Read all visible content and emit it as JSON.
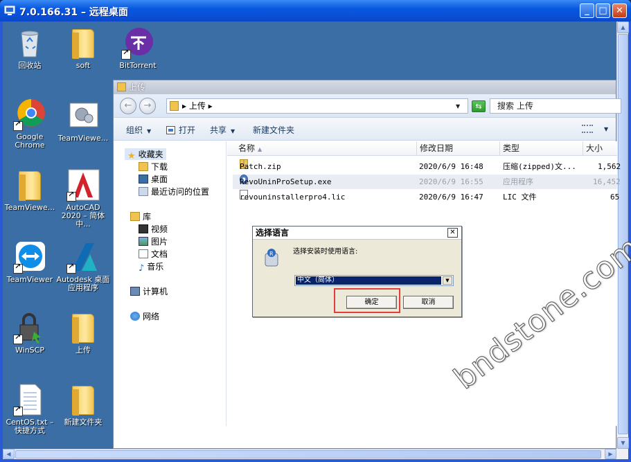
{
  "window": {
    "title": "7.0.166.31 – 远程桌面",
    "min_label": "_",
    "max_label": "□",
    "close_label": "✕"
  },
  "desktop": {
    "icons": [
      {
        "label": "回收站",
        "icon": "recycle-bin-icon"
      },
      {
        "label": "soft",
        "icon": "folder-icon"
      },
      {
        "label": "BitTorrent",
        "icon": "bittorrent-icon"
      },
      {
        "label": "Google Chrome",
        "icon": "chrome-icon"
      },
      {
        "label": "TeamViewe...",
        "icon": "teamviewer-config-icon"
      },
      {
        "label": "TeamViewe...",
        "icon": "folder-icon"
      },
      {
        "label": "AutoCAD 2020 – 简体中...",
        "icon": "autocad-icon"
      },
      {
        "label": "TeamViewer",
        "icon": "teamviewer-icon"
      },
      {
        "label": "Autodesk 桌面应用程序",
        "icon": "autodesk-app-icon"
      },
      {
        "label": "WinSCP",
        "icon": "winscp-icon"
      },
      {
        "label": "上传",
        "icon": "folder-icon"
      },
      {
        "label": "CentOS.txt – 快捷方式",
        "icon": "text-file-icon"
      },
      {
        "label": "新建文件夹",
        "icon": "folder-icon"
      }
    ]
  },
  "explorer": {
    "title": "上传",
    "address": "▸ 上传 ▸",
    "search_placeholder": "搜索 上传",
    "toolbar": {
      "organize": "组织",
      "open": "打开",
      "share": "共享",
      "new_folder": "新建文件夹"
    },
    "nav": {
      "favorites": "收藏夹",
      "downloads": "下载",
      "desktop": "桌面",
      "recent": "最近访问的位置",
      "libraries": "库",
      "videos": "视频",
      "pictures": "图片",
      "documents": "文档",
      "music": "音乐",
      "computer": "计算机",
      "network": "网络"
    },
    "columns": {
      "name": "名称",
      "modified": "修改日期",
      "type": "类型",
      "size": "大小"
    },
    "files": [
      {
        "name": "Patch.zip",
        "modified": "2020/6/9 16:48",
        "type": "压缩(zipped)文...",
        "size": "1,562"
      },
      {
        "name": "RevoUninProSetup.exe",
        "modified": "2020/6/9 16:55",
        "type": "应用程序",
        "size": "16,452"
      },
      {
        "name": "revouninstallerpro4.lic",
        "modified": "2020/6/9 16:47",
        "type": "LIC 文件",
        "size": "65"
      }
    ]
  },
  "dialog": {
    "title": "选择语言",
    "prompt": "选择安装时使用语言:",
    "selected_language": "中文（简体）",
    "ok_label": "确定",
    "cancel_label": "取消"
  },
  "watermark": "bndstone.com"
}
